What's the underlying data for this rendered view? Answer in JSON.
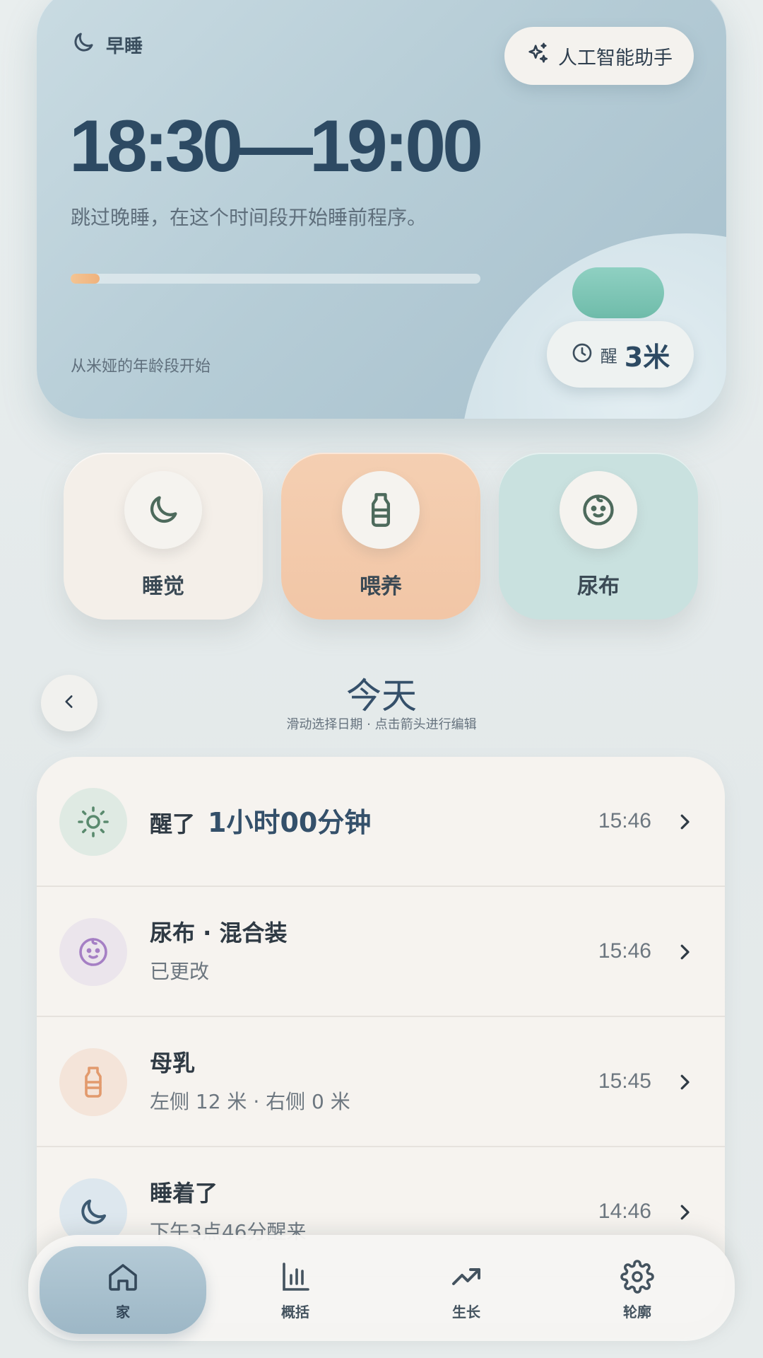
{
  "colors": {
    "primary": "#2d4a63",
    "accent_peach": "#f2c6a6",
    "accent_mint": "#c9e1df",
    "progress": "#f0b27c"
  },
  "hero": {
    "tag": "早睡",
    "tag_icon": "moon-icon",
    "ai_button": "人工智能助手",
    "ai_icon": "sparkles-icon",
    "time_range": "18:30—19:00",
    "description": "跳过晚睡，在这个时间段开始睡前程序。",
    "progress_fraction": 0.07,
    "footer": "从米娅的年龄段开始",
    "wake_label": "醒",
    "wake_value": "3米",
    "wake_icon": "clock-icon"
  },
  "quick_actions": [
    {
      "label": "睡觉",
      "icon": "moon-icon"
    },
    {
      "label": "喂养",
      "icon": "bottle-icon"
    },
    {
      "label": "尿布",
      "icon": "baby-face-icon"
    }
  ],
  "day": {
    "title": "今天",
    "subtitle": "滑动选择日期 · 点击箭头进行编辑"
  },
  "log": [
    {
      "title": "醒了",
      "accent": "1小时00分钟",
      "subtitle": "",
      "time": "15:46",
      "icon": "sun-icon"
    },
    {
      "title": "尿布 · 混合装",
      "accent": "",
      "subtitle": "已更改",
      "time": "15:46",
      "icon": "baby-face-icon"
    },
    {
      "title": "母乳",
      "accent": "",
      "subtitle": "左侧 12 米 · 右侧 0 米",
      "time": "15:45",
      "icon": "bottle-icon"
    },
    {
      "title": "睡着了",
      "accent": "",
      "subtitle": "下午3点46分醒来",
      "time": "14:46",
      "icon": "moon-icon"
    }
  ],
  "nav": [
    {
      "label": "家",
      "icon": "home-icon",
      "active": true
    },
    {
      "label": "概括",
      "icon": "bar-chart-icon",
      "active": false
    },
    {
      "label": "生长",
      "icon": "trend-up-icon",
      "active": false
    },
    {
      "label": "轮廓",
      "icon": "gear-icon",
      "active": false
    }
  ]
}
